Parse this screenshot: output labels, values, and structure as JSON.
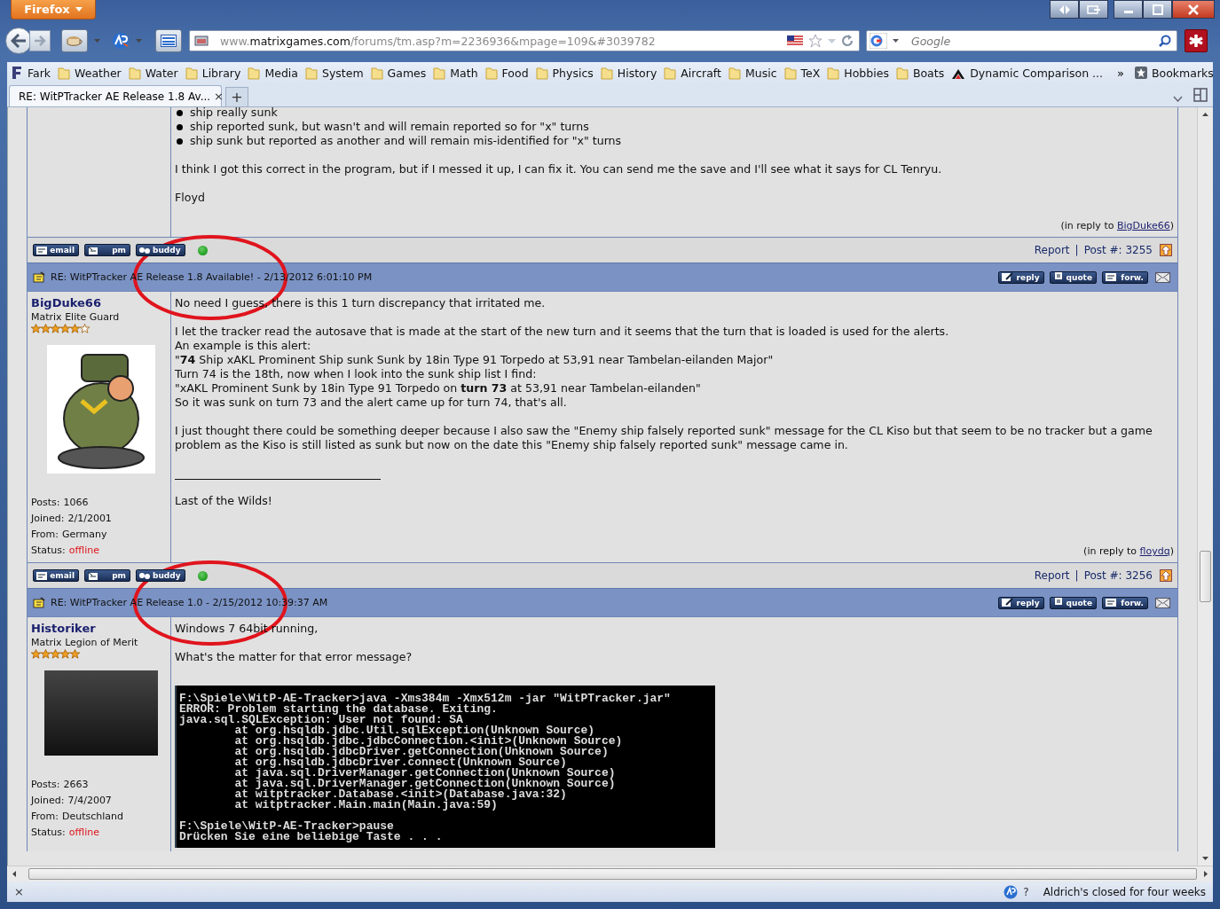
{
  "window": {
    "menu_button": "Firefox"
  },
  "navigation": {
    "url": {
      "prefix": "www.",
      "domain": "matrixgames.com",
      "path": "/forums/tm.asp?m=2236936&mpage=109&#3039782"
    },
    "search": {
      "placeholder": "Google"
    }
  },
  "bookmarks": {
    "items": [
      {
        "label": "Fark",
        "kind": "site"
      },
      {
        "label": "Weather",
        "kind": "folder"
      },
      {
        "label": "Water",
        "kind": "folder"
      },
      {
        "label": "Library",
        "kind": "folder"
      },
      {
        "label": "Media",
        "kind": "folder"
      },
      {
        "label": "System",
        "kind": "folder"
      },
      {
        "label": "Games",
        "kind": "folder"
      },
      {
        "label": "Math",
        "kind": "folder"
      },
      {
        "label": "Food",
        "kind": "folder"
      },
      {
        "label": "Physics",
        "kind": "folder"
      },
      {
        "label": "History",
        "kind": "folder"
      },
      {
        "label": "Aircraft",
        "kind": "folder"
      },
      {
        "label": "Music",
        "kind": "folder"
      },
      {
        "label": "TeX",
        "kind": "folder"
      },
      {
        "label": "Hobbies",
        "kind": "folder"
      },
      {
        "label": "Boats",
        "kind": "folder"
      },
      {
        "label": "Dynamic Comparison ...",
        "kind": "site"
      }
    ],
    "overflow": "»",
    "menu": "Bookmarks"
  },
  "tabs": [
    {
      "label": "RE: WitPTracker AE Release 1.8 Av...",
      "close": "×",
      "selected": true
    }
  ],
  "new_tab": "+",
  "posts": [
    {
      "body": [
        {
          "kind": "list",
          "items": [
            "ship really sunk",
            "ship reported sunk, but wasn't and will remain reported so for \"x\" turns",
            "ship sunk but reported as another and will remain mis-identified for \"x\" turns"
          ]
        },
        {
          "kind": "paragraph",
          "lines": [
            "I think I got this correct in the program, but if I messed it up, I can fix it. You can send me the save and I'll see what it says for CL Tenryu."
          ]
        },
        {
          "kind": "paragraph",
          "lines": [
            "Floyd"
          ]
        }
      ],
      "reply_to": {
        "prefix": "(in reply to ",
        "name": "BigDuke66",
        "suffix": ")"
      },
      "footer": {
        "buttons": [
          "email",
          "pm",
          "buddy"
        ],
        "report": "Report",
        "separator": "|",
        "post_number": "Post #: 3255"
      }
    },
    {
      "header": {
        "title": "RE: WitPTracker AE Release 1.8 Available! - 2/13/2012 6:01:10 PM",
        "buttons": [
          "reply",
          "quote",
          "forw."
        ]
      },
      "circled": true,
      "author": {
        "name": "BigDuke66",
        "rank": "Matrix Elite Guard",
        "stars": 5,
        "extra_empty_star": true,
        "avatar": {
          "kind": "cartoon"
        },
        "stats": [
          {
            "label": "Posts:",
            "value": "1066"
          },
          {
            "label": "Joined:",
            "value": "2/1/2001"
          },
          {
            "label": "From:",
            "value": "Germany"
          },
          {
            "label": "Status:",
            "value": "offline",
            "online": false
          }
        ]
      },
      "body": [
        {
          "kind": "paragraph",
          "lines": [
            "No need I guess, there is this 1 turn discrepancy that irritated me."
          ]
        },
        {
          "kind": "paragraph",
          "lines": [
            "I let the tracker read the autosave that is made at the start of the new turn and it seems that the turn that is loaded is used for the alerts.",
            "An example is this alert:",
            "\"**74** Ship xAKL Prominent Ship sunk Sunk by 18in Type 91 Torpedo at 53,91 near Tambelan-eilanden Major\"",
            "Turn 74 is the 18th, now when I look into the sunk ship list I find:",
            "\"xAKL Prominent Sunk by 18in Type 91 Torpedo on **turn 73** at 53,91 near Tambelan-eilanden\"",
            "So it was sunk on turn 73 and the alert came up for turn 74, that's all."
          ]
        },
        {
          "kind": "paragraph",
          "lines": [
            "I just thought there could be something deeper because I also saw the \"Enemy ship falsely reported sunk\" message for the CL Kiso but that seem to be no tracker but a game problem as the Kiso is still listed as sunk but now on the date this \"Enemy ship falsely reported sunk\" message came in."
          ]
        },
        {
          "kind": "signature_rule"
        },
        {
          "kind": "paragraph",
          "lines": [
            "Last of the Wilds!"
          ]
        }
      ],
      "reply_to": {
        "prefix": "(in reply to ",
        "name": "floydq",
        "suffix": ")"
      },
      "footer": {
        "buttons": [
          "email",
          "pm",
          "buddy"
        ],
        "report": "Report",
        "separator": "|",
        "post_number": "Post #: 3256"
      }
    },
    {
      "header": {
        "title": "RE: WitPTracker AE Release 1.0 - 2/15/2012 10:39:37 AM",
        "buttons": [
          "reply",
          "quote",
          "forw."
        ]
      },
      "circled": true,
      "author": {
        "name": "Historiker",
        "rank": "Matrix Legion of Merit",
        "stars": 5,
        "extra_empty_star": false,
        "avatar": {
          "kind": "photo"
        },
        "stats": [
          {
            "label": "Posts:",
            "value": "2663"
          },
          {
            "label": "Joined:",
            "value": "7/4/2007"
          },
          {
            "label": "From:",
            "value": "Deutschland"
          },
          {
            "label": "Status:",
            "value": "offline",
            "online": false
          }
        ]
      },
      "body": [
        {
          "kind": "paragraph",
          "lines": [
            "Windows 7 64bit running,"
          ]
        },
        {
          "kind": "paragraph",
          "lines": [
            "What's the matter for that error message?"
          ]
        },
        {
          "kind": "console",
          "blocks": [
            [
              "F:\\Spiele\\WitP-AE-Tracker>java -Xms384m -Xmx512m -jar \"WitPTracker.jar\"",
              "ERROR: Problem starting the database. Exiting.",
              "java.sql.SQLException: User not found: SA",
              "        at org.hsqldb.jdbc.Util.sqlException(Unknown Source)",
              "        at org.hsqldb.jdbc.jdbcConnection.<init>(Unknown Source)",
              "        at org.hsqldb.jdbcDriver.getConnection(Unknown Source)",
              "        at org.hsqldb.jdbcDriver.connect(Unknown Source)",
              "        at java.sql.DriverManager.getConnection(Unknown Source)",
              "        at java.sql.DriverManager.getConnection(Unknown Source)",
              "        at witptracker.Database.<init>(Database.java:32)",
              "        at witptracker.Main.main(Main.java:59)"
            ],
            [
              "F:\\Spiele\\WitP-AE-Tracker>pause",
              "Drücken Sie eine beliebige Taste . . ."
            ]
          ]
        }
      ]
    }
  ],
  "status_bar": {
    "close": "×",
    "help": "?",
    "text": "Aldrich's closed for four weeks"
  }
}
